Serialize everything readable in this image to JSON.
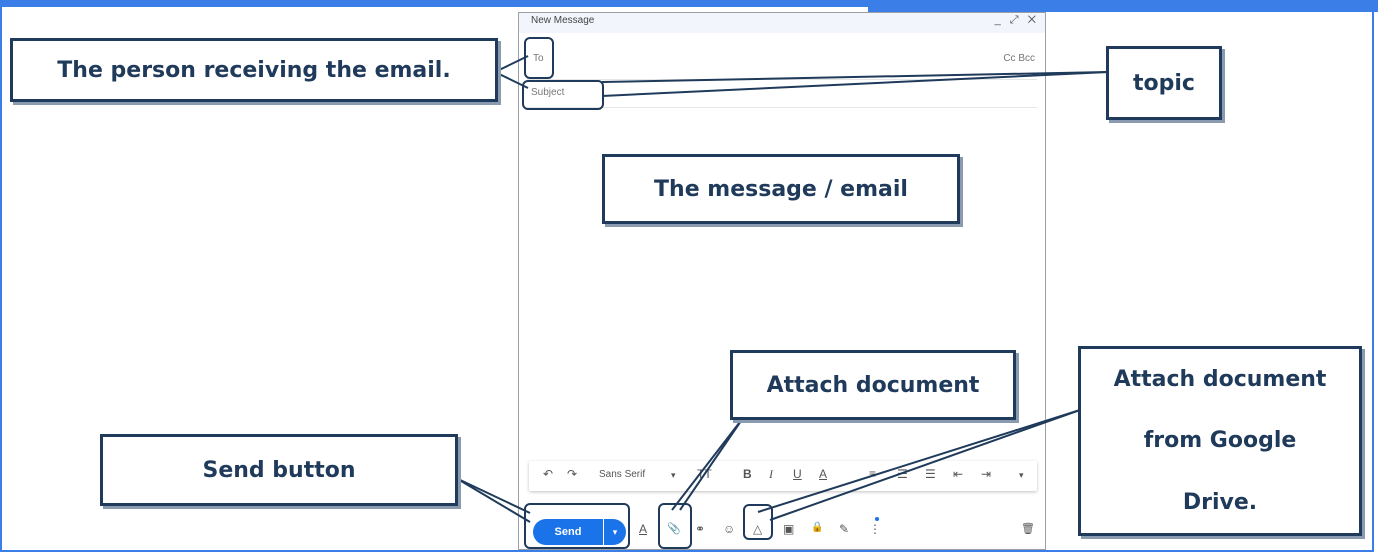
{
  "compose": {
    "title": "New Message",
    "header_icons": "_ ⤢ ✕",
    "to_label": "To",
    "cc_bcc": "Cc Bcc",
    "subject_placeholder": "Subject",
    "toolbar": {
      "undo": "↶",
      "redo": "↷",
      "font": "Sans Serif",
      "font_arrow": "▾",
      "size": "TT",
      "bold": "B",
      "italic": "I",
      "underline": "U",
      "text_color": "A",
      "align": "≡",
      "numbered_list": "☰",
      "bullet_list": "☰",
      "indent_less": "⇤",
      "indent_more": "⇥",
      "more": "▾"
    },
    "send_label": "Send",
    "send_dropdown": "▾",
    "bottom_icons": {
      "format": "A",
      "attach": "📎",
      "link": "⚭",
      "emoji": "☺",
      "drive": "△",
      "photo": "▣",
      "lock": "🔒",
      "signature": "✎",
      "more": "⋮",
      "trash": "🗑"
    }
  },
  "callouts": {
    "recipient": "The person receiving the email.",
    "topic": "topic",
    "message": "The message / email",
    "attach": "Attach document",
    "drive_line1": "Attach document",
    "drive_line2": "from Google",
    "drive_line3": "Drive.",
    "send": "Send button"
  },
  "colors": {
    "frame": "#3b7ee8",
    "callout_border": "#1f3a5a",
    "send_button": "#1a73e8"
  }
}
